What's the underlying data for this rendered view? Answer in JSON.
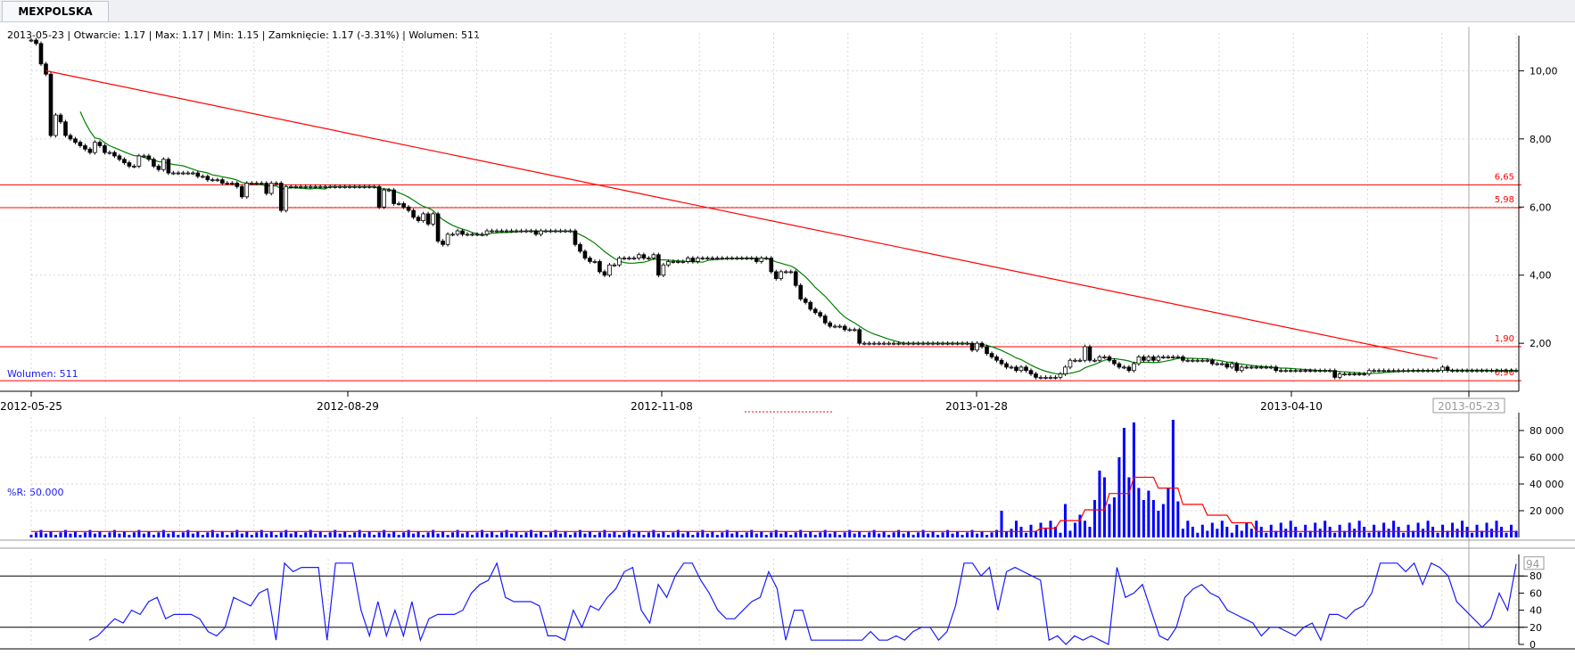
{
  "tab": {
    "label": "MEXPOLSKA"
  },
  "info": {
    "text": "2013-05-23 | Otwarcie: 1.17 | Max: 1.17 | Min: 1.15 | Zamknięcie: 1.17 (-3.31%)  | Wolumen: 511"
  },
  "indicators": {
    "volume_label": "Wolumen: 511",
    "wr_label": "%R: 50.000"
  },
  "colors": {
    "candle": "#000000",
    "ma": "#008000",
    "lines": "#ff0000",
    "volume": "#0000ff",
    "volume_ma": "#ff0000",
    "wr": "#1a1aff"
  },
  "chart_data": [
    {
      "type": "candlestick",
      "title": "",
      "x_ticks": [
        "2012-05-25",
        "2012-08-29",
        "2012-11-08",
        "2013-01-28",
        "2013-04-10",
        "2013-05-23"
      ],
      "y_ticks": [
        "2,00",
        "4,00",
        "6,00",
        "8,00",
        "10,00"
      ],
      "ylim": [
        0.8,
        10.9
      ],
      "grid": true,
      "horizontal_lines": [
        {
          "value": 6.65,
          "label": "6,65"
        },
        {
          "value": 5.98,
          "label": "5,98"
        },
        {
          "value": 1.9,
          "label": "1,90"
        },
        {
          "value": 0.9,
          "label": "0,90"
        }
      ],
      "trendline": {
        "from": {
          "index": 3,
          "value": 10.0
        },
        "to": {
          "index": 287,
          "value": 1.55
        }
      },
      "closes": [
        10.9,
        10.8,
        10.2,
        9.9,
        8.1,
        8.7,
        8.5,
        8.1,
        8.0,
        7.9,
        7.8,
        7.7,
        7.6,
        7.9,
        7.8,
        7.6,
        7.6,
        7.5,
        7.4,
        7.3,
        7.2,
        7.2,
        7.5,
        7.5,
        7.4,
        7.2,
        7.1,
        7.4,
        7.0,
        7.0,
        7.0,
        7.0,
        7.0,
        7.0,
        6.9,
        6.9,
        6.8,
        6.8,
        6.8,
        6.7,
        6.7,
        6.7,
        6.6,
        6.3,
        6.7,
        6.7,
        6.7,
        6.7,
        6.4,
        6.7,
        6.7,
        5.9,
        6.6,
        6.6,
        6.6,
        6.6,
        6.6,
        6.6,
        6.6,
        6.6,
        6.6,
        6.6,
        6.6,
        6.6,
        6.6,
        6.6,
        6.6,
        6.6,
        6.6,
        6.6,
        6.6,
        6.0,
        6.5,
        6.5,
        6.1,
        6.1,
        6.0,
        5.9,
        5.7,
        5.6,
        5.8,
        5.5,
        5.8,
        5.0,
        4.9,
        5.2,
        5.2,
        5.3,
        5.2,
        5.2,
        5.2,
        5.2,
        5.2,
        5.3,
        5.3,
        5.3,
        5.3,
        5.3,
        5.3,
        5.3,
        5.3,
        5.3,
        5.3,
        5.2,
        5.3,
        5.3,
        5.3,
        5.3,
        5.3,
        5.3,
        5.3,
        4.9,
        4.7,
        4.5,
        4.4,
        4.4,
        4.1,
        4.0,
        4.3,
        4.3,
        4.5,
        4.5,
        4.5,
        4.5,
        4.6,
        4.5,
        4.5,
        4.6,
        4.0,
        4.3,
        4.4,
        4.4,
        4.4,
        4.4,
        4.5,
        4.4,
        4.5,
        4.5,
        4.5,
        4.5,
        4.5,
        4.5,
        4.5,
        4.5,
        4.5,
        4.5,
        4.5,
        4.5,
        4.4,
        4.5,
        4.5,
        4.1,
        3.9,
        4.1,
        4.1,
        4.1,
        3.7,
        3.3,
        3.2,
        3.0,
        2.9,
        2.8,
        2.6,
        2.5,
        2.5,
        2.5,
        2.4,
        2.4,
        2.4,
        2.0,
        2.0,
        2.0,
        2.0,
        2.0,
        2.0,
        2.0,
        2.0,
        2.0,
        2.0,
        2.0,
        2.0,
        2.0,
        2.0,
        2.0,
        2.0,
        2.0,
        2.0,
        2.0,
        2.0,
        2.0,
        2.0,
        2.0,
        1.8,
        2.0,
        1.9,
        1.7,
        1.6,
        1.5,
        1.4,
        1.3,
        1.3,
        1.2,
        1.3,
        1.2,
        1.1,
        1.0,
        1.0,
        1.0,
        1.0,
        1.0,
        1.1,
        1.3,
        1.5,
        1.5,
        1.5,
        1.9,
        1.5,
        1.5,
        1.6,
        1.6,
        1.5,
        1.4,
        1.3,
        1.3,
        1.2,
        1.4,
        1.6,
        1.5,
        1.6,
        1.5,
        1.6,
        1.6,
        1.6,
        1.6,
        1.6,
        1.5,
        1.5,
        1.5,
        1.5,
        1.5,
        1.5,
        1.4,
        1.4,
        1.4,
        1.3,
        1.4,
        1.2,
        1.3,
        1.3,
        1.3,
        1.3,
        1.3,
        1.3,
        1.3,
        1.2,
        1.2,
        1.2,
        1.2,
        1.2,
        1.2,
        1.2,
        1.2,
        1.2,
        1.2,
        1.2,
        1.2,
        1.0,
        1.1,
        1.1,
        1.1,
        1.1,
        1.1,
        1.1,
        1.2,
        1.2,
        1.2,
        1.2,
        1.2,
        1.2,
        1.2,
        1.2,
        1.2,
        1.2,
        1.2,
        1.2,
        1.2,
        1.2,
        1.2,
        1.3,
        1.2,
        1.2,
        1.2,
        1.2,
        1.2,
        1.2,
        1.2,
        1.2,
        1.2,
        1.2,
        1.2,
        1.2,
        1.2,
        1.2,
        1.2
      ]
    },
    {
      "type": "bar",
      "title": "Wolumen",
      "y_ticks": [
        "20 000",
        "40 000",
        "60 000",
        "80 000"
      ],
      "ylim": [
        0,
        90000
      ],
      "grid": true,
      "spikes": [
        {
          "index": 198,
          "value": 20000
        },
        {
          "index": 211,
          "value": 25000
        },
        {
          "index": 214,
          "value": 17000
        },
        {
          "index": 217,
          "value": 28000
        },
        {
          "index": 218,
          "value": 50000
        },
        {
          "index": 219,
          "value": 45000
        },
        {
          "index": 220,
          "value": 25000
        },
        {
          "index": 221,
          "value": 30000
        },
        {
          "index": 222,
          "value": 60000
        },
        {
          "index": 223,
          "value": 82000
        },
        {
          "index": 224,
          "value": 45000
        },
        {
          "index": 225,
          "value": 86000
        },
        {
          "index": 226,
          "value": 37000
        },
        {
          "index": 227,
          "value": 28000
        },
        {
          "index": 228,
          "value": 35000
        },
        {
          "index": 229,
          "value": 28000
        },
        {
          "index": 230,
          "value": 20000
        },
        {
          "index": 231,
          "value": 25000
        },
        {
          "index": 232,
          "value": 37000
        },
        {
          "index": 233,
          "value": 88000
        },
        {
          "index": 234,
          "value": 27000
        }
      ],
      "ma_values": [
        0.3,
        1,
        2,
        3.5,
        5,
        4,
        2.5,
        1.5,
        0.8,
        0.3
      ],
      "ma_peak_value": 45000
    },
    {
      "type": "line",
      "title": "%R",
      "y_ticks": [
        "0",
        "20",
        "40",
        "60",
        "80"
      ],
      "ylim": [
        0,
        100
      ],
      "reference_lines": [
        20,
        80
      ],
      "last_value_label": "94",
      "values": [
        5,
        10,
        20,
        30,
        25,
        40,
        35,
        50,
        55,
        30,
        35,
        35,
        35,
        30,
        15,
        10,
        20,
        55,
        50,
        45,
        60,
        65,
        5,
        95,
        85,
        90,
        90,
        90,
        5,
        95,
        95,
        95,
        40,
        10,
        50,
        10,
        40,
        10,
        50,
        5,
        30,
        35,
        35,
        35,
        40,
        60,
        70,
        75,
        95,
        55,
        50,
        50,
        50,
        45,
        10,
        10,
        5,
        40,
        20,
        45,
        40,
        55,
        65,
        85,
        90,
        40,
        25,
        70,
        55,
        80,
        95,
        95,
        75,
        60,
        40,
        30,
        30,
        40,
        50,
        55,
        85,
        65,
        5,
        40,
        40,
        5,
        5,
        5,
        5,
        5,
        5,
        5,
        15,
        5,
        5,
        10,
        5,
        15,
        20,
        20,
        5,
        15,
        45,
        95,
        95,
        80,
        90,
        40,
        85,
        90,
        85,
        80,
        75,
        5,
        10,
        0,
        10,
        5,
        10,
        5,
        0,
        90,
        55,
        60,
        70,
        40,
        10,
        5,
        20,
        55,
        65,
        70,
        60,
        55,
        40,
        35,
        30,
        25,
        10,
        20,
        20,
        15,
        10,
        20,
        25,
        5,
        35,
        35,
        30,
        40,
        45,
        60,
        95,
        95,
        95,
        85,
        95,
        70,
        95,
        90,
        80,
        50,
        40,
        30,
        20,
        30,
        60,
        40,
        94
      ]
    }
  ]
}
